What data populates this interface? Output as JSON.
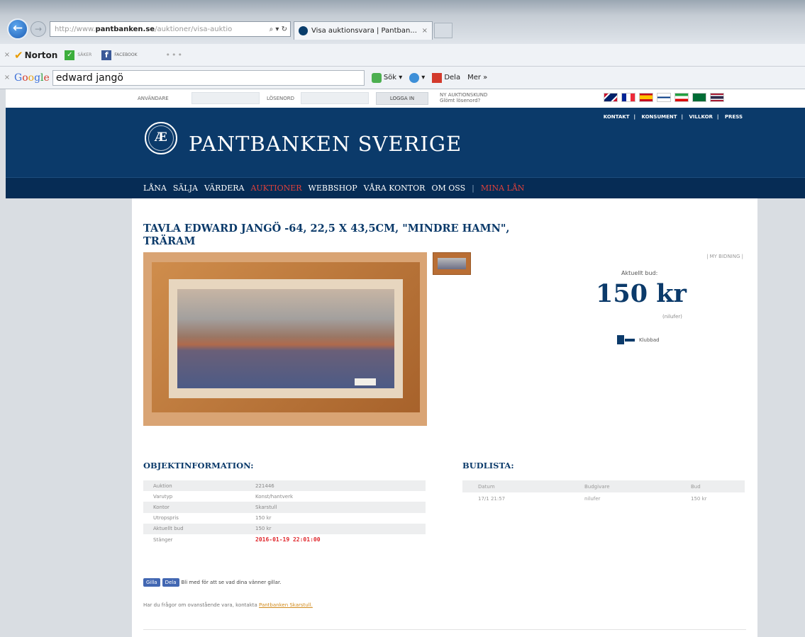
{
  "browser": {
    "url_prefix": "http://www.",
    "url_domain": "pantbanken.se",
    "url_path": "/auktioner/visa-auktio",
    "address_tools": "⌕ ▾ ↻",
    "tab_title": "Visa auktionsvara | Pantban...",
    "tab_close": "×",
    "back_icon": "←",
    "forward_icon": "→"
  },
  "toolbar1": {
    "close": "×",
    "norton_label": "Norton",
    "safe_text": "SÄKER",
    "facebook_text": "FACEBOOK",
    "dots": "•••"
  },
  "toolbar2": {
    "close": "×",
    "search_value": "edward jangö",
    "sok_label": "Sök ▾",
    "globe_label": "▾",
    "dela_label": "Dela",
    "mer_label": "Mer »"
  },
  "login": {
    "user_label": "ANVÄNDARE",
    "password_label": "LÖSENORD",
    "login_button": "LOGGA IN",
    "new_customer": "NY AUKTIONSKUND",
    "forgot": "Glömt lösenord?"
  },
  "header": {
    "seal_text": "Æ",
    "brand": "PANTBANKEN SVERIGE",
    "top_links": [
      "KONTAKT",
      "KONSUMENT",
      "VILLKOR",
      "PRESS"
    ],
    "link_separator": "|"
  },
  "nav": {
    "items": [
      "LÅNA",
      "SÄLJA",
      "VÄRDERA",
      "AUKTIONER",
      "WEBBSHOP",
      "VÅRA KONTOR",
      "OM OSS"
    ],
    "separator": "|",
    "mina_lan": "MINA LÅN"
  },
  "colors": {
    "brand_blue": "#0b3a6a",
    "nav_dark": "#062c55",
    "active_red": "#e0413b",
    "deadline_red": "#e0262b"
  },
  "item": {
    "title": "TAVLA EDWARD JANGÖ -64, 22,5 X 43,5CM, \"MINDRE HAMN\", TRÄRAM"
  },
  "bid": {
    "my_bids_link": "| MY BIDNING |",
    "current_label": "Aktuellt bud:",
    "current_amount": "150 kr",
    "bidder": "(nilufer)",
    "gavel_text": "Klubbad"
  },
  "objektinfo": {
    "heading": "OBJEKTINFORMATION:",
    "rows": [
      {
        "label": "Auktion",
        "value": "221446"
      },
      {
        "label": "Varutyp",
        "value": "Konst/hantverk"
      },
      {
        "label": "Kontor",
        "value": "Skarstull"
      },
      {
        "label": "Utropspris",
        "value": "150 kr"
      },
      {
        "label": "Aktuellt bud",
        "value": "150 kr"
      },
      {
        "label": "Stänger",
        "value": "2016-01-19 22:01:00"
      }
    ]
  },
  "budlista": {
    "heading": "BUDLISTA:",
    "headers": [
      "Datum",
      "Budgivare",
      "Bud"
    ],
    "rows": [
      [
        "17/1 21:57",
        "nilufer",
        "150 kr"
      ]
    ]
  },
  "social": {
    "like": "Gilla",
    "share": "Dela",
    "text": "Bli med för att se vad dina vänner gillar."
  },
  "contact": {
    "text": "Har du frågor om ovanstående vara, kontakta ",
    "link": "Pantbanken Skarstull."
  }
}
